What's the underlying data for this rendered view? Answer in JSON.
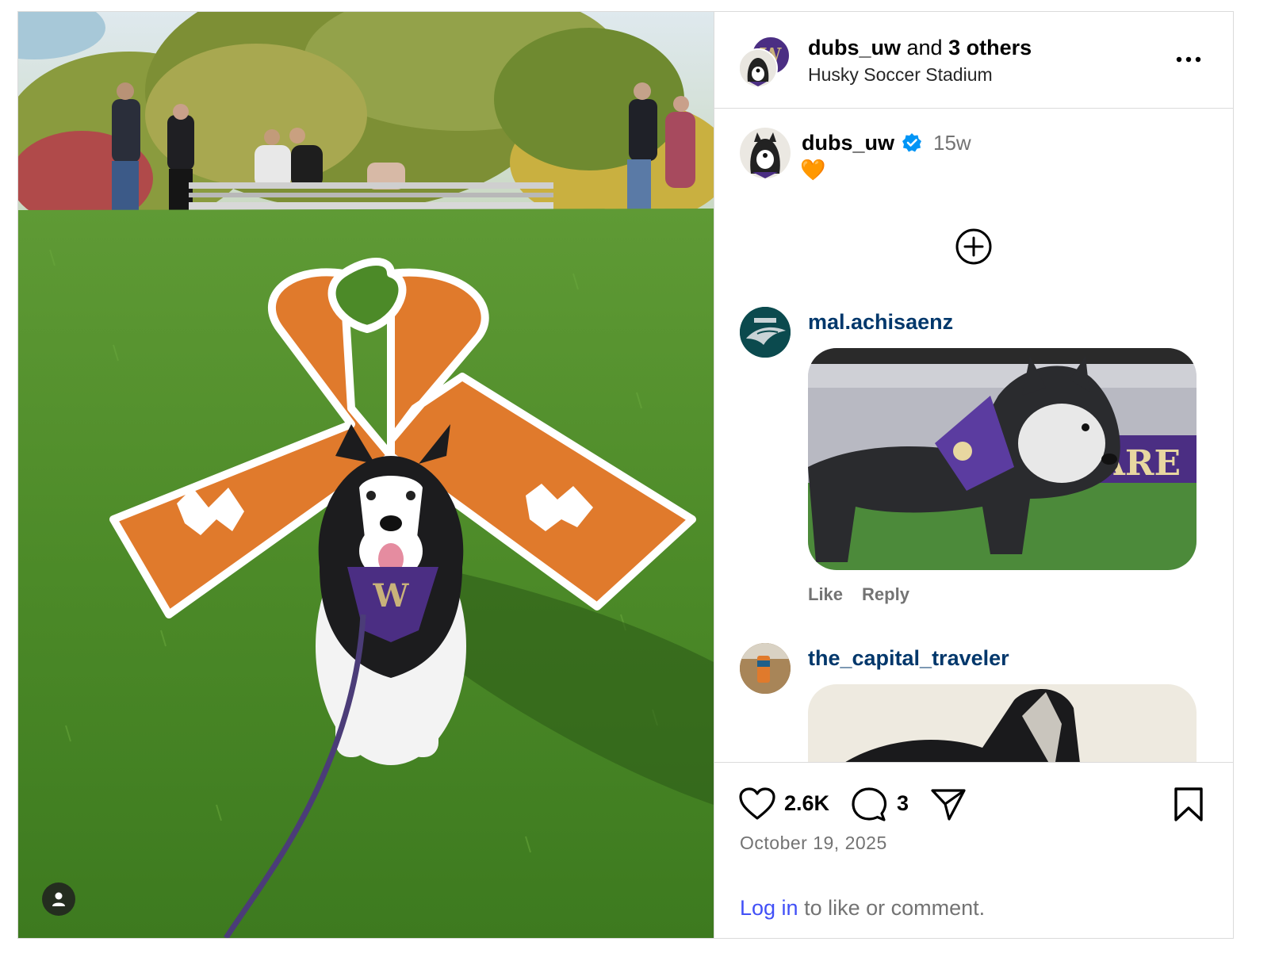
{
  "header": {
    "author": "dubs_uw",
    "and_text": " and ",
    "others": "3 others",
    "location": "Husky Soccer Stadium"
  },
  "caption": {
    "username": "dubs_uw",
    "time": "15w",
    "text": "🧡"
  },
  "comments": [
    {
      "username": "mal.achisaenz",
      "like_label": "Like",
      "reply_label": "Reply"
    },
    {
      "username": "the_capital_traveler"
    }
  ],
  "footer": {
    "likes": "2.6K",
    "comments_count": "3",
    "date": "October 19, 2025",
    "login_link": "Log in",
    "login_rest": " to like or comment."
  },
  "icons": {
    "like": "heart-icon",
    "comment": "comment-bubble-icon",
    "share": "send-icon",
    "save": "bookmark-icon",
    "more": "more-options-icon",
    "add": "plus-circle-icon",
    "verified": "verified-badge-icon",
    "tagged": "user-tag-icon"
  },
  "colors": {
    "ribbon_orange": "#e07a2c",
    "uw_purple": "#4b2e83",
    "link_blue": "#4150f7",
    "username_blue": "#00376b",
    "verified_blue": "#0095f6"
  }
}
